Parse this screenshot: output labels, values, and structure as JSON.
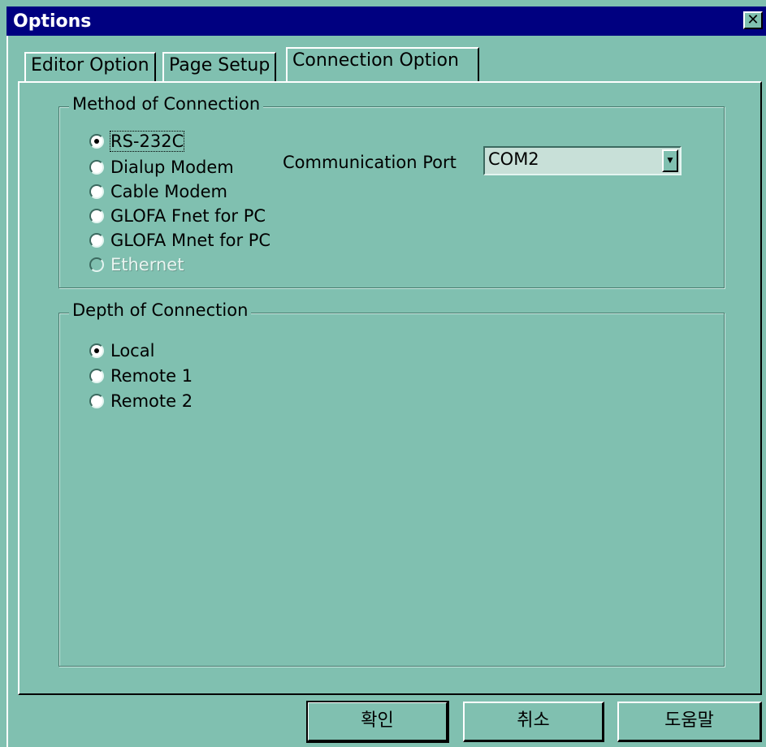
{
  "window": {
    "title": "Options",
    "close_glyph": "✕"
  },
  "tabs": [
    {
      "label": "Editor Option",
      "active": false
    },
    {
      "label": "Page Setup",
      "active": false
    },
    {
      "label": "Connection Option",
      "active": true
    }
  ],
  "method_group": {
    "title": "Method of Connection",
    "options": [
      {
        "label": "RS-232C",
        "checked": true,
        "enabled": true
      },
      {
        "label": "Dialup Modem",
        "checked": false,
        "enabled": true
      },
      {
        "label": "Cable Modem",
        "checked": false,
        "enabled": true
      },
      {
        "label": "GLOFA Fnet for PC",
        "checked": false,
        "enabled": true
      },
      {
        "label": "GLOFA Mnet for PC",
        "checked": false,
        "enabled": true
      },
      {
        "label": "Ethernet",
        "checked": false,
        "enabled": false
      }
    ],
    "port_label": "Communication Port",
    "port_value": "COM2",
    "dropdown_icon": "▼"
  },
  "depth_group": {
    "title": "Depth of Connection",
    "options": [
      {
        "label": "Local",
        "checked": true
      },
      {
        "label": "Remote 1",
        "checked": false
      },
      {
        "label": "Remote 2",
        "checked": false
      }
    ]
  },
  "buttons": {
    "ok": "확인",
    "cancel": "취소",
    "help": "도움말"
  },
  "colors": {
    "face": "#80c0b0",
    "titlebar": "#000080"
  }
}
